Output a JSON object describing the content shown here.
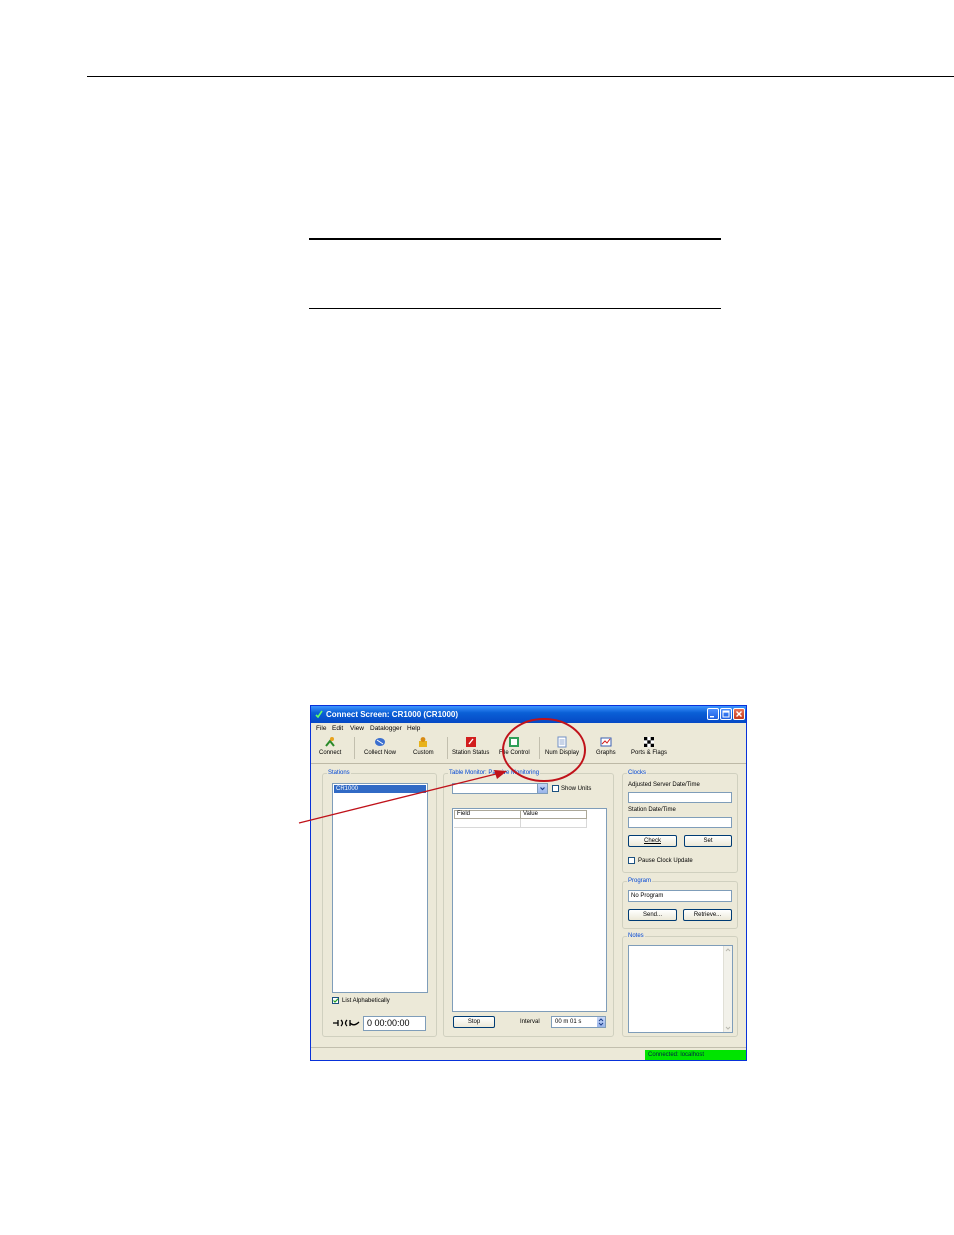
{
  "window": {
    "title": "Connect Screen: CR1000 (CR1000)"
  },
  "menu": {
    "items": [
      "File",
      "Edit",
      "View",
      "Datalogger",
      "Help"
    ]
  },
  "toolbar": {
    "items": [
      {
        "label": "Connect",
        "icon": "connect-icon"
      },
      {
        "label": "Collect Now",
        "icon": "collect-now-icon"
      },
      {
        "label": "Custom",
        "icon": "custom-icon"
      },
      {
        "label": "Station Status",
        "icon": "station-status-icon"
      },
      {
        "label": "File Control",
        "icon": "file-control-icon"
      },
      {
        "label": "Num Display",
        "icon": "num-display-icon"
      },
      {
        "label": "Graphs",
        "icon": "graphs-icon"
      },
      {
        "label": "Ports & Flags",
        "icon": "ports-flags-icon"
      }
    ]
  },
  "stations": {
    "title": "Stations",
    "selected": "CR1000",
    "list_alpha_label": "List Alphabetically",
    "timer": "0 00:00:00"
  },
  "monitor": {
    "title": "Table Monitor: Passive Monitoring",
    "show_units_label": "Show Units",
    "col_field": "Field",
    "col_value": "Value",
    "stop_label": "Stop",
    "interval_label": "Interval",
    "interval_value": "00 m 01 s"
  },
  "clocks": {
    "title": "Clocks",
    "adjusted_label": "Adjusted Server Date/Time",
    "station_label": "Station Date/Time",
    "check_label": "Check",
    "set_label": "Set",
    "pause_label": "Pause Clock Update"
  },
  "program": {
    "title": "Program",
    "value": "No Program",
    "send_label": "Send...",
    "retrieve_label": "Retrieve..."
  },
  "notes": {
    "title": "Notes"
  },
  "status": {
    "text": "Connected: localhost"
  },
  "colors": {
    "annotation": "#c0121a",
    "status_green": "#00e400",
    "titlebar": "#0a5fd6"
  }
}
